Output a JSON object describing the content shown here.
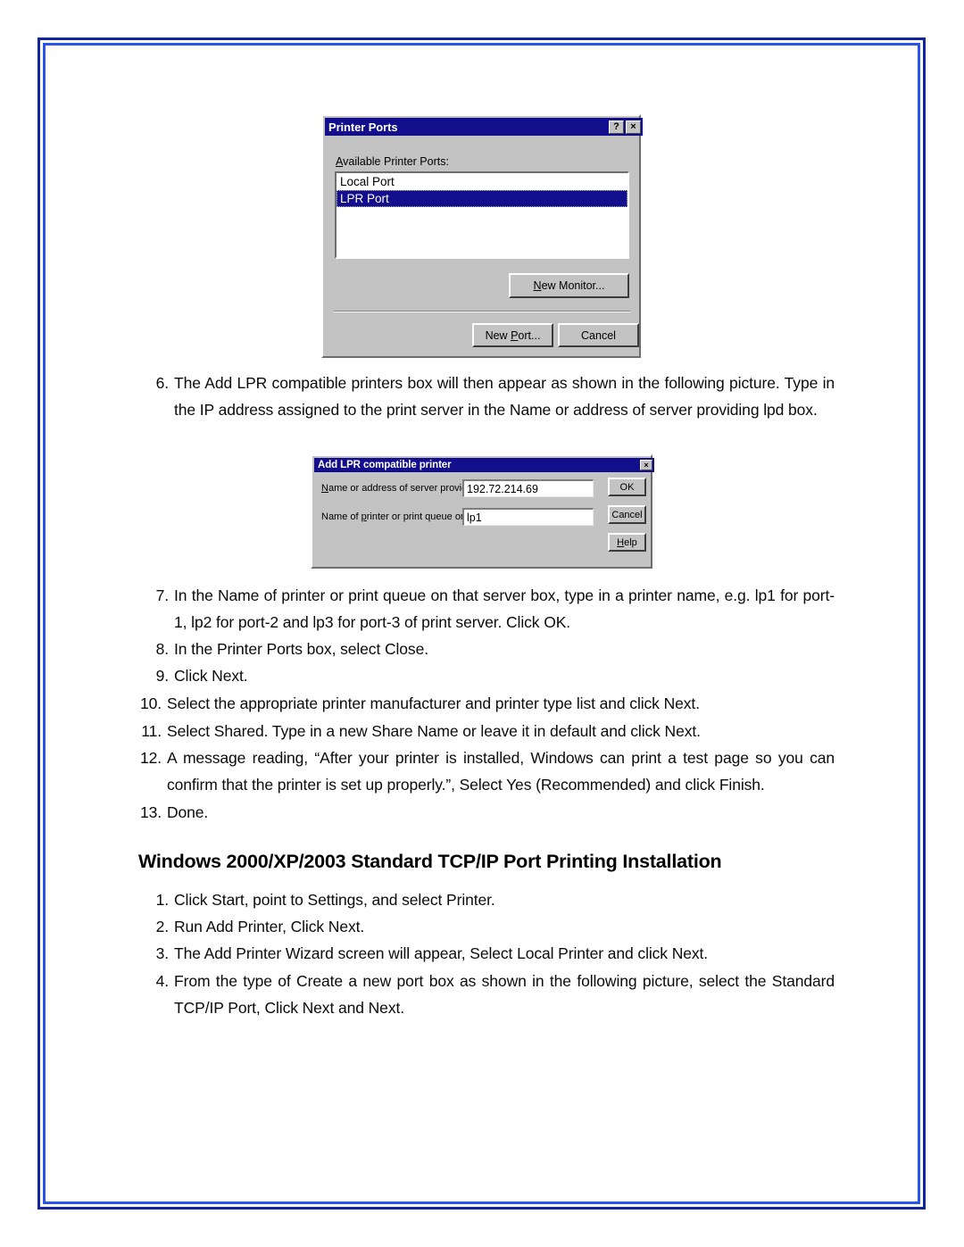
{
  "page": {
    "frame_color_outer": "#12259b",
    "frame_color_inner": "#2a56e8"
  },
  "dialog_printer_ports": {
    "title": "Printer Ports",
    "help_button": "?",
    "close_button": "×",
    "list_label": "Available Printer Ports:",
    "list_label_accel": "A",
    "list_label_rest": "vailable Printer Ports:",
    "items": [
      {
        "label": "Local Port",
        "selected": false
      },
      {
        "label": "LPR Port",
        "selected": true
      }
    ],
    "new_monitor_button": "New Monitor...",
    "new_monitor_accel": "N",
    "new_monitor_rest": "ew Monitor...",
    "new_port_button": "New Port...",
    "new_port_pre": "New ",
    "new_port_accel": "P",
    "new_port_rest": "ort...",
    "cancel_button": "Cancel"
  },
  "dialog_add_lpr": {
    "title": "Add LPR compatible printer",
    "close_button": "×",
    "label_server_accel": "N",
    "label_server_rest": "ame or address of server providing lpd:",
    "label_server_full": "Name or address of server providing lpd:",
    "label_queue_pre": "Name of ",
    "label_queue_accel": "p",
    "label_queue_rest": "rinter or print queue on that server:",
    "label_queue_full": "Name of printer or print queue on that server:",
    "server_value": "192.72.214.69",
    "queue_value": "lp1",
    "ok_button": "OK",
    "cancel_button": "Cancel",
    "help_button": "Help",
    "help_accel": "H",
    "help_rest": "elp"
  },
  "steps_lpr": [
    {
      "num": "6.",
      "text": "The Add LPR compatible printers box will then appear as shown in the following picture. Type in the IP address assigned to the print server in the Name or address of server providing lpd box."
    },
    {
      "num": "7.",
      "text": "In the Name of printer or print queue on that server box, type in a printer name, e.g. lp1 for port-1, lp2 for port-2 and lp3 for port-3 of print server. Click OK."
    },
    {
      "num": "8.",
      "text": "In the Printer Ports box, select Close."
    },
    {
      "num": "9.",
      "text": "Click Next."
    },
    {
      "num": "10.",
      "text": "Select the appropriate printer manufacturer and printer type list and click Next."
    },
    {
      "num": "11.",
      "text": "Select Shared. Type in a new Share Name or leave it in default and click Next."
    },
    {
      "num": "12.",
      "text": "A message reading, “After your printer is installed, Windows can print a test page so you can confirm that the printer is set up properly.”, Select Yes (Recommended) and click Finish."
    },
    {
      "num": "13.",
      "text": "Done."
    }
  ],
  "section": {
    "heading": "Windows 2000/XP/2003 Standard TCP/IP Port Printing Installation",
    "steps": [
      {
        "num": "1.",
        "text": "Click Start, point to Settings, and select Printer."
      },
      {
        "num": "2.",
        "text": "Run Add Printer, Click Next."
      },
      {
        "num": "3.",
        "text": "The Add Printer Wizard screen will appear, Select Local Printer and click Next."
      },
      {
        "num": "4.",
        "text": "From the type of Create a new port box as shown in the following picture, select the Standard TCP/IP Port, Click Next and Next."
      }
    ]
  }
}
